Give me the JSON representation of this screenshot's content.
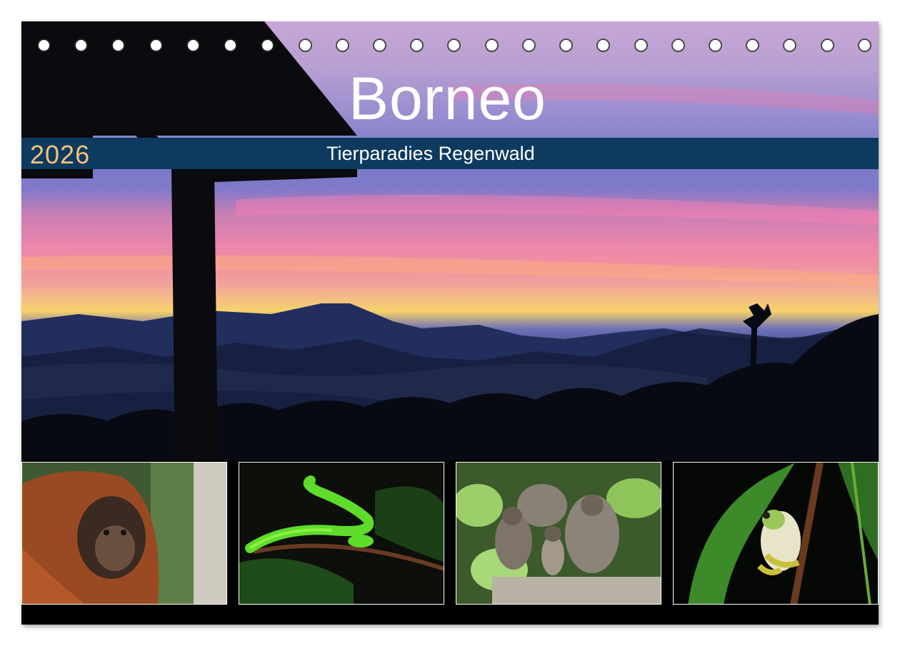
{
  "calendar": {
    "year": "2026",
    "title": "Borneo",
    "subtitle": "Tierparadies Regenwald"
  },
  "binding_holes": 23,
  "colors": {
    "band": "#0e3a60",
    "year_text": "#f2c27a",
    "title_text": "#ffffff"
  },
  "photos": [
    {
      "subject": "orangutan"
    },
    {
      "subject": "green pit viper snake"
    },
    {
      "subject": "macaque monkeys"
    },
    {
      "subject": "tree frog"
    }
  ]
}
